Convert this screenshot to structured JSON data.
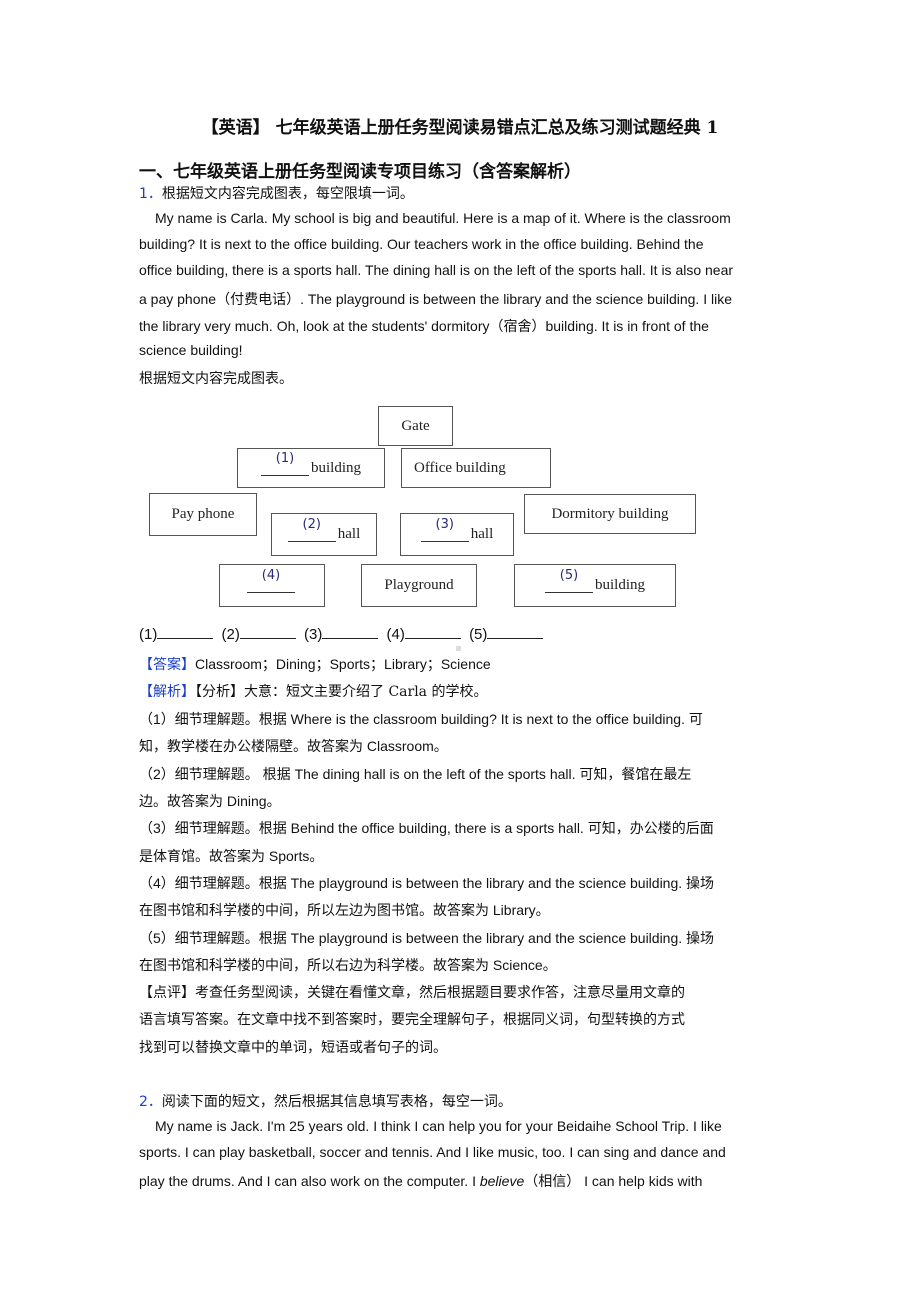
{
  "document": {
    "title": "【英语】 七年级英语上册任务型阅读易错点汇总及练习测试题经典 1",
    "section_heading": "一、七年级英语上册任务型阅读专项目练习（含答案解析）"
  },
  "question1": {
    "number": "1．",
    "instruction": "根据短文内容完成图表，每空限填一词。",
    "passage_lines": [
      "My name is Carla. My school is big and beautiful. Here is a map of it. Where is the classroom",
      "building? It is next to the office building. Our teachers work in the office building. Behind the",
      "office building, there is a sports hall. The dining hall is on the left of the sports hall. It is also near",
      "a pay phone（付费电话）. The playground is between the library and the science building. I like",
      "the library very much. Oh, look at the students' dormitory（宿舍）building. It is in front of the",
      "science building!"
    ],
    "diagram_caption": "根据短文内容完成图表。",
    "diagram": {
      "gate": "Gate",
      "box1_num": "(1)",
      "box1_suffix": "building",
      "office": "Office building",
      "pay_phone": "Pay phone",
      "box2_num": "(2)",
      "box2_suffix": "hall",
      "box3_num": "(3)",
      "box3_suffix": "hall",
      "dormitory": "Dormitory building",
      "box4_num": "(4)",
      "playground": "Playground",
      "box5_num": "(5)",
      "box5_suffix": "building"
    },
    "blank_labels": [
      "(1)",
      "(2)",
      "(3)",
      "(4)",
      "(5)"
    ],
    "answer_tag": "【答案】",
    "answer_text": "Classroom；Dining；Sports；Library；Science",
    "analysis_tag": "【解析】",
    "analysis_intro": "【分析】大意：短文主要介绍了 Carla 的学校。",
    "explanations": [
      "（1）细节理解题。根据 Where is the classroom building? It is next to the office building. 可",
      "知，教学楼在办公楼隔壁。故答案为 Classroom。",
      "（2）细节理解题。 根据 The dining hall is on the left of the sports hall. 可知，餐馆在最左",
      "边。故答案为 Dining。",
      "（3）细节理解题。根据 Behind the office building, there is a sports hall. 可知，办公楼的后面",
      "是体育馆。故答案为 Sports。",
      "（4）细节理解题。根据 The playground is between the library and the science building. 操场",
      "在图书馆和科学楼的中间，所以左边为图书馆。故答案为 Library。",
      "（5）细节理解题。根据 The playground is between the library and the science building. 操场",
      "在图书馆和科学楼的中间，所以右边为科学楼。故答案为 Science。",
      "【点评】考查任务型阅读，关键在看懂文章，然后根据题目要求作答，注意尽量用文章的",
      "语言填写答案。在文章中找不到答案时，要完全理解句子，根据同义词，句型转换的方式",
      "找到可以替换文章中的单词，短语或者句子的词。"
    ]
  },
  "question2": {
    "number": "2．",
    "instruction": "阅读下面的短文，然后根据其信息填写表格，每空一词。",
    "passage_lines": [
      "My name is Jack. I'm 25 years old. I think I can help you for your Beidaihe School Trip. I like",
      "sports. I can play basketball, soccer and tennis. And I like music, too. I can sing and dance and"
    ],
    "line3_before": "play the drums. And I can also work on the computer. I ",
    "line3_italic": "believe",
    "line3_after": "（相信） I can help kids with"
  }
}
